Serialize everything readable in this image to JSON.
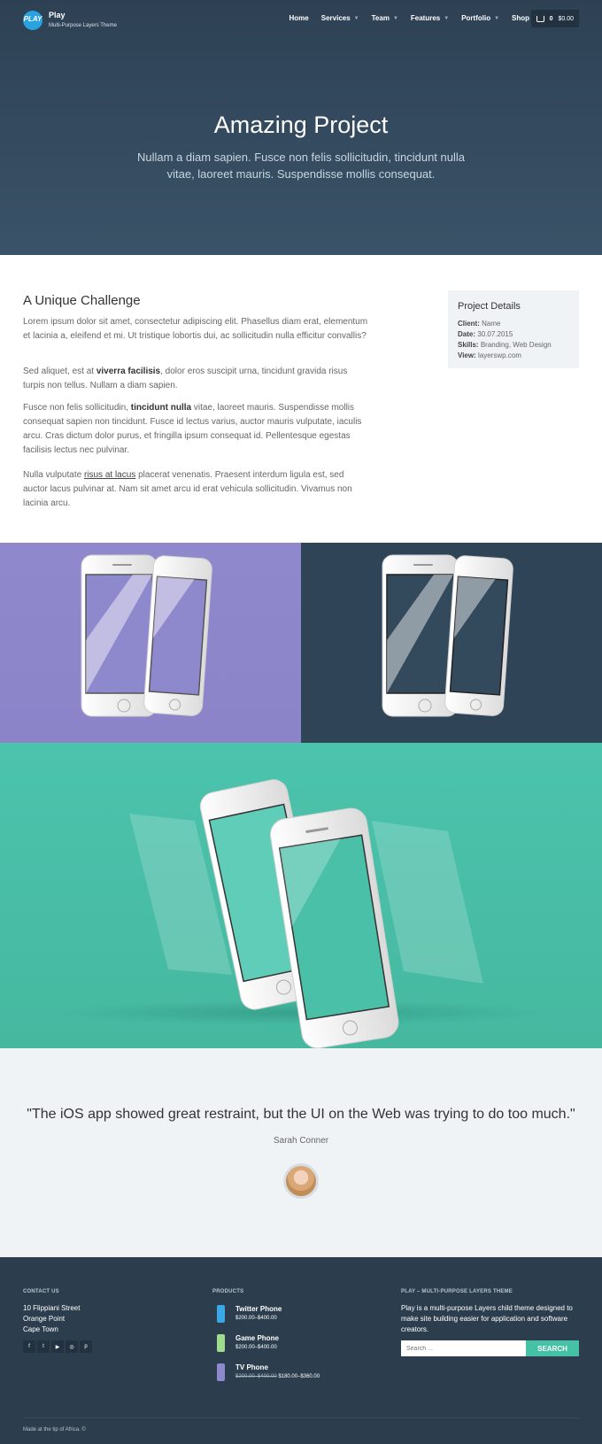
{
  "header": {
    "logo_text": "PLAY",
    "brand_name": "Play",
    "brand_tagline": "Multi-Purpose Layers Theme",
    "nav": [
      {
        "label": "Home",
        "has_dropdown": false
      },
      {
        "label": "Services",
        "has_dropdown": true
      },
      {
        "label": "Team",
        "has_dropdown": true
      },
      {
        "label": "Features",
        "has_dropdown": true
      },
      {
        "label": "Portfolio",
        "has_dropdown": true
      },
      {
        "label": "Shop",
        "has_dropdown": true
      }
    ],
    "cart": {
      "count": "0",
      "total": "$0.00"
    }
  },
  "hero": {
    "title": "Amazing Project",
    "subtitle": "Nullam a diam sapien. Fusce non felis sollicitudin, tincidunt nulla vitae, laoreet mauris. Suspendisse mollis consequat."
  },
  "content": {
    "heading": "A Unique Challenge",
    "p1": "Lorem ipsum dolor sit amet, consectetur adipiscing elit. Phasellus diam erat, elementum et lacinia a, eleifend et mi. Ut tristique lobortis dui, ac sollicitudin nulla efficitur convallis?",
    "p2_before": "Sed aliquet, est at ",
    "p2_bold": "viverra facilisis",
    "p2_after": ", dolor eros suscipit urna, tincidunt gravida risus turpis non tellus. Nullam a diam sapien.",
    "p3_before": "Fusce non felis sollicitudin, ",
    "p3_bold": "tincidunt nulla",
    "p3_after": " vitae, laoreet mauris. Suspendisse mollis consequat sapien non tincidunt. Fusce id lectus varius, auctor mauris vulputate, iaculis arcu. Cras dictum dolor purus, et fringilla ipsum consequat id. Pellentesque egestas facilisis lectus nec pulvinar.",
    "p4_before": "Nulla vulputate ",
    "p4_link": "risus at lacus",
    "p4_after": " placerat venenatis. Praesent interdum ligula est, sed auctor lacus pulvinar at. Nam sit amet arcu id erat vehicula sollicitudin. Vivamus non lacinia arcu."
  },
  "project_details": {
    "title": "Project Details",
    "rows": [
      {
        "label": "Client:",
        "value": "Name"
      },
      {
        "label": "Date:",
        "value": "30.07.2015"
      },
      {
        "label": "Skills:",
        "value": "Branding, Web Design"
      },
      {
        "label": "View:",
        "value": "layerswp.com"
      }
    ]
  },
  "colors": {
    "hero_bg": "#34495e",
    "purple_panel": "#8e88cc",
    "dark_panel": "#2f4457",
    "green_panel": "#4ac0a9",
    "accent": "#45c1a6",
    "footer_bg": "#2c3e4e"
  },
  "testimonial": {
    "quote": "\"The iOS app showed great restraint, but the UI on the Web was trying to do too much.\"",
    "author": "Sarah Conner"
  },
  "footer": {
    "contact": {
      "heading": "CONTACT US",
      "lines": [
        "10 Flippiani Street",
        "Orange Point",
        "Cape Town"
      ],
      "social": [
        {
          "icon": "facebook-icon",
          "glyph": "f"
        },
        {
          "icon": "twitter-icon",
          "glyph": "t"
        },
        {
          "icon": "youtube-icon",
          "glyph": "▶"
        },
        {
          "icon": "dribbble-icon",
          "glyph": "◎"
        },
        {
          "icon": "pinterest-icon",
          "glyph": "p"
        }
      ]
    },
    "products": {
      "heading": "PRODUCTS",
      "items": [
        {
          "name": "Twitter Phone",
          "old_price": "",
          "price": "$200.00–$400.00",
          "thumb_color": "#3aa7e6"
        },
        {
          "name": "Game Phone",
          "old_price": "",
          "price": "$200.00–$400.00",
          "thumb_color": "#9fdc8c"
        },
        {
          "name": "TV Phone",
          "old_price": "$200.00–$400.00",
          "price": "$180.00–$360.00",
          "thumb_color": "#8e88cc"
        }
      ]
    },
    "about": {
      "heading": "PLAY – MULTI-PURPOSE LAYERS THEME",
      "text": "Play is a multi-purpose Layers child theme designed to make site building easier for application and software creators.",
      "search_placeholder": "Search ...",
      "search_button": "SEARCH"
    },
    "copyright": "Made at the tip of Africa. ©"
  }
}
